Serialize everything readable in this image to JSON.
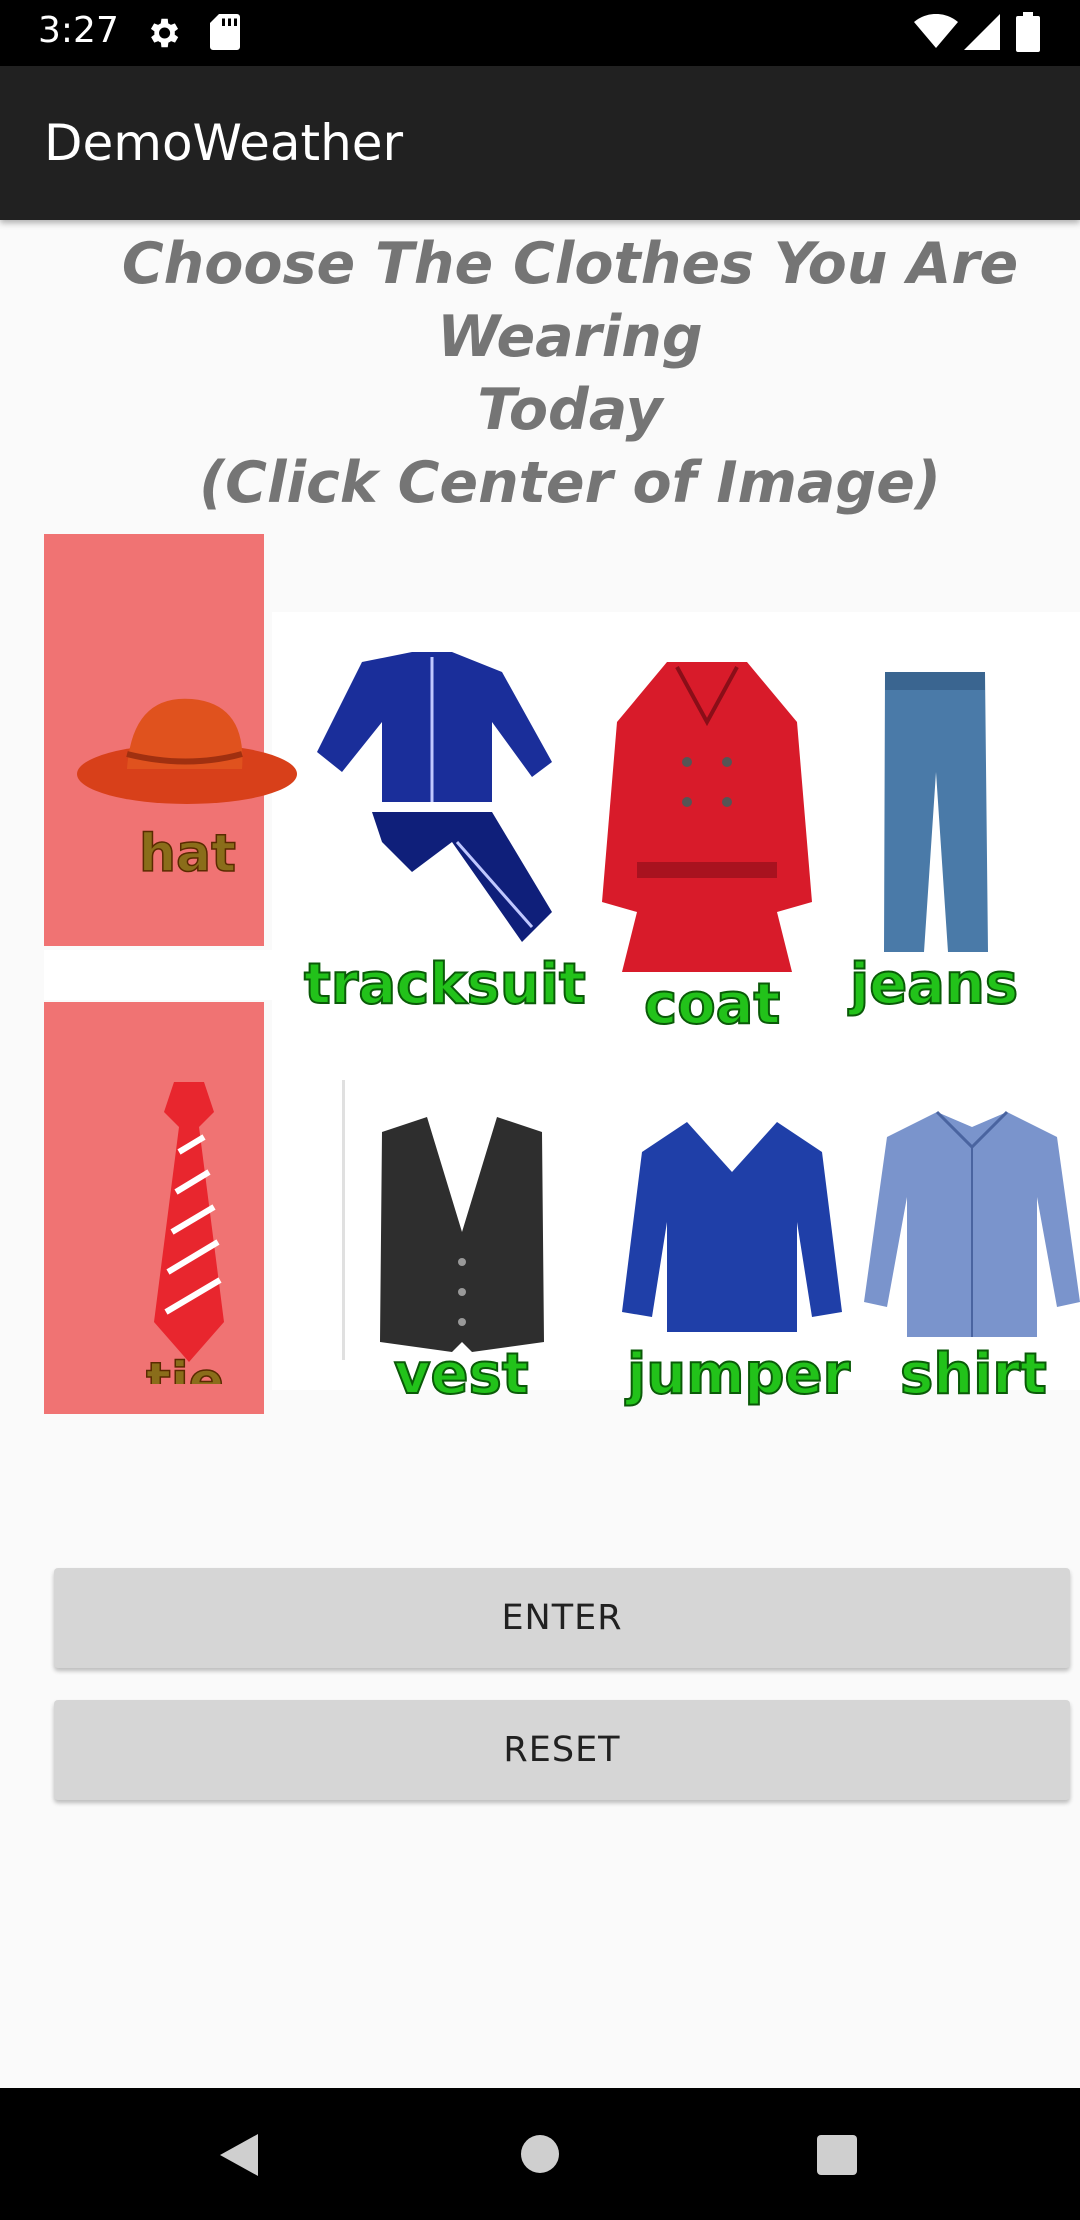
{
  "status_bar": {
    "time": "3:27",
    "icons": [
      "settings-icon",
      "sd-card-icon",
      "wifi-icon",
      "signal-icon",
      "battery-icon"
    ]
  },
  "app_bar": {
    "title": "DemoWeather"
  },
  "heading": {
    "line1": "Choose The Clothes You Are Wearing",
    "line2": "Today",
    "line3": "(Click Center of Image)"
  },
  "tiles": [
    {
      "label": "hat",
      "selected": true
    },
    {
      "label": "tie",
      "selected": true
    }
  ],
  "clothes": [
    {
      "label": "tracksuit"
    },
    {
      "label": "coat"
    },
    {
      "label": "jeans"
    },
    {
      "label": "vest"
    },
    {
      "label": "jumper"
    },
    {
      "label": "shirt"
    }
  ],
  "buttons": {
    "enter": "ENTER",
    "reset": "RESET"
  },
  "colors": {
    "tile_highlight": "#f07373",
    "label_green": "#22c21a",
    "app_bar": "#212121"
  },
  "nav_bar": {
    "icons": [
      "back-icon",
      "home-icon",
      "recents-icon"
    ]
  }
}
